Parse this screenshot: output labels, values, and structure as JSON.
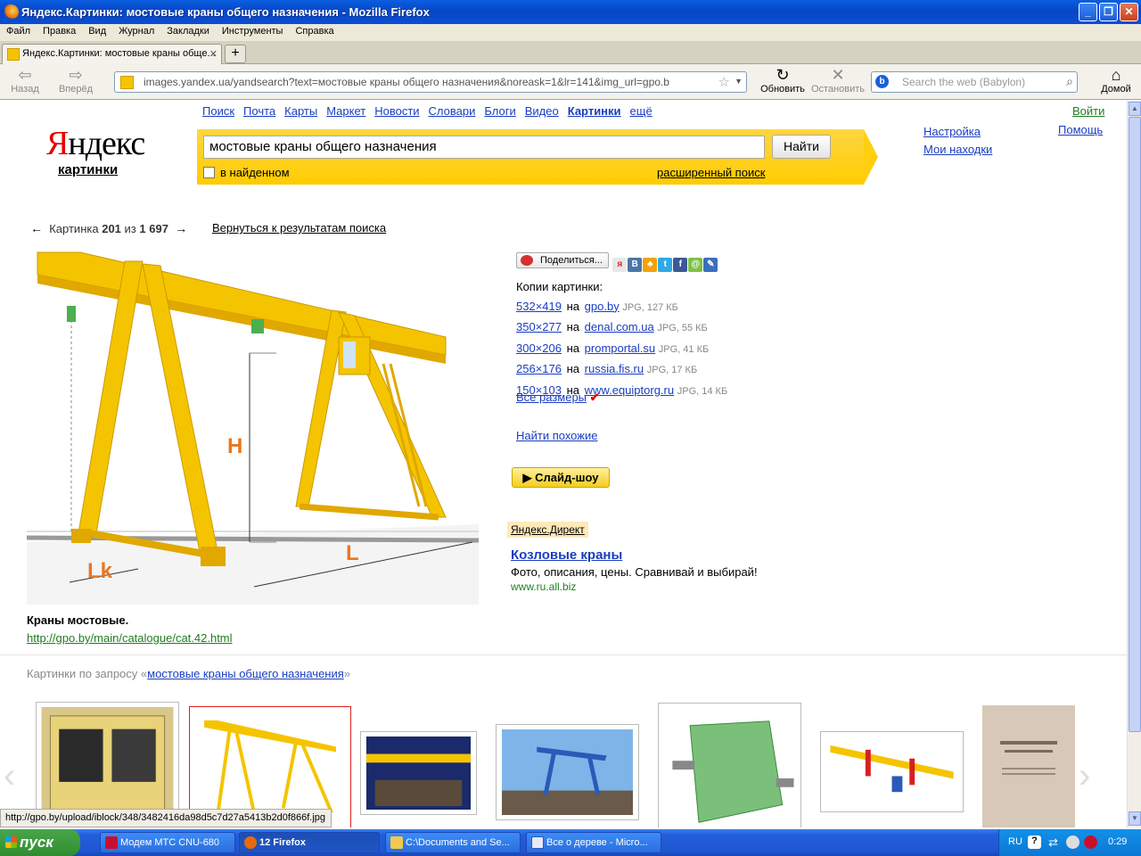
{
  "window": {
    "title": "Яндекс.Картинки: мостовые краны общего назначения - Mozilla Firefox"
  },
  "menu": [
    "Файл",
    "Правка",
    "Вид",
    "Журнал",
    "Закладки",
    "Инструменты",
    "Справка"
  ],
  "tab": {
    "label": "Яндекс.Картинки: мостовые краны обще..."
  },
  "nav": {
    "back": "Назад",
    "forward": "Вперёд",
    "url": "images.yandex.ua/yandsearch?text=мостовые краны общего назначения&noreask=1&lr=141&img_url=gpo.b",
    "reload": "Обновить",
    "stop": "Остановить",
    "search_placeholder": "Search the web (Babylon)",
    "home": "Домой"
  },
  "yandex": {
    "logo_first": "Я",
    "logo_rest": "ндекс",
    "logo_sub": "картинки",
    "services": [
      "Поиск",
      "Почта",
      "Карты",
      "Маркет",
      "Новости",
      "Словари",
      "Блоги",
      "Видео",
      "Картинки",
      "ещё"
    ],
    "signin": "Войти",
    "settings": "Настройка",
    "my_finds": "Мои находки",
    "help": "Помощь",
    "query": "мостовые краны общего назначения",
    "find_button": "Найти",
    "in_found": "в найденном",
    "advanced": "расширенный поиск"
  },
  "pager": {
    "prefix": "Картинка",
    "current": "201",
    "of": "из",
    "total": "1 697",
    "back_to_results": "Вернуться к результатам поиска"
  },
  "image": {
    "label_h": "H",
    "label_lk": "Lk",
    "label_l": "L",
    "caption": "Краны мостовые.",
    "source_url": "http://gpo.by/main/catalogue/cat.42.html"
  },
  "share": {
    "button": "Поделиться..."
  },
  "copies": {
    "title": "Копии картинки:",
    "on": "на",
    "items": [
      {
        "size": "532×419",
        "site": "gpo.by",
        "meta": "JPG, 127 КБ"
      },
      {
        "size": "350×277",
        "site": "denal.com.ua",
        "meta": "JPG, 55 КБ"
      },
      {
        "size": "300×206",
        "site": "promportal.su",
        "meta": "JPG, 41 КБ"
      },
      {
        "size": "256×176",
        "site": "russia.fis.ru",
        "meta": "JPG, 17 КБ"
      },
      {
        "size": "150×103",
        "site": "www.equiptorg.ru",
        "meta": "JPG, 14 КБ"
      }
    ],
    "all_sizes": "Все размеры",
    "find_similar": "Найти похожие",
    "slideshow": "▶ Слайд-шоу"
  },
  "direct": {
    "label": "Яндекс.Директ",
    "title": "Козловые краны",
    "text": "Фото, описания, цены. Сравнивай и выбирай!",
    "url": "www.ru.all.biz"
  },
  "related": {
    "prefix": "Картинки по запросу «",
    "query": "мостовые краны общего назначения",
    "suffix": "»"
  },
  "status": {
    "text": "http://gpo.by/upload/iblock/348/3482416da98d5c7d27a5413b2d0f866f.jpg"
  },
  "taskbar": {
    "start": "пуск",
    "tasks": [
      "Модем МТС CNU-680",
      "12 Firefox",
      "C:\\Documents and Se...",
      "Все о дереве - Micro..."
    ],
    "lang": "RU",
    "clock": "0:29"
  },
  "colors": {
    "crane_yellow": "#f5c400",
    "yandex_red": "#e50000",
    "link_blue": "#1a3dc1",
    "url_green": "#1f7e1f"
  }
}
